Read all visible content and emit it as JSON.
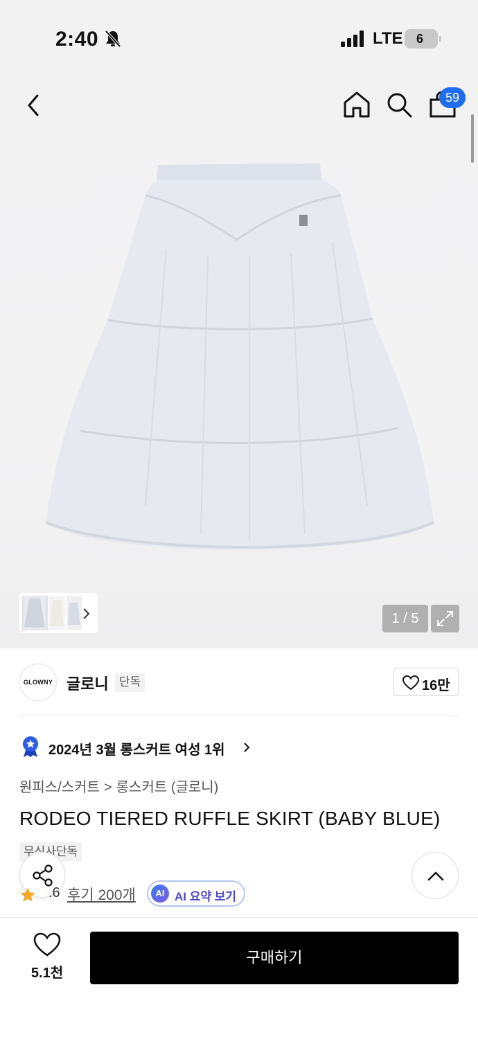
{
  "status_bar": {
    "time": "2:40",
    "network": "LTE",
    "battery": "6"
  },
  "header": {
    "cart_count": "59"
  },
  "gallery": {
    "counter": "1 / 5"
  },
  "brand": {
    "logo_text": "GLOWNY",
    "name": "글로니",
    "tag": "단독",
    "likes": "16만"
  },
  "ranking": {
    "text": "2024년 3월 롱스커트 여성 1위"
  },
  "breadcrumb": {
    "category": "원피스/스커트",
    "subcategory": "롱스커트 (글로니)",
    "separator": ">"
  },
  "product": {
    "title": "RODEO TIERED RUFFLE SKIRT (BABY BLUE)",
    "partner_tag": "무신사단독",
    "rating": ".6",
    "reviews": "후기 200개",
    "ai_badge": "AI",
    "ai_label": "AI 요약 보기"
  },
  "bottom": {
    "like_count": "5.1천",
    "buy_label": "구매하기"
  },
  "colors": {
    "accent": "#1e6cf0",
    "skirt": "#e4e7ee",
    "star": "#f5a623",
    "button": "#000000"
  }
}
